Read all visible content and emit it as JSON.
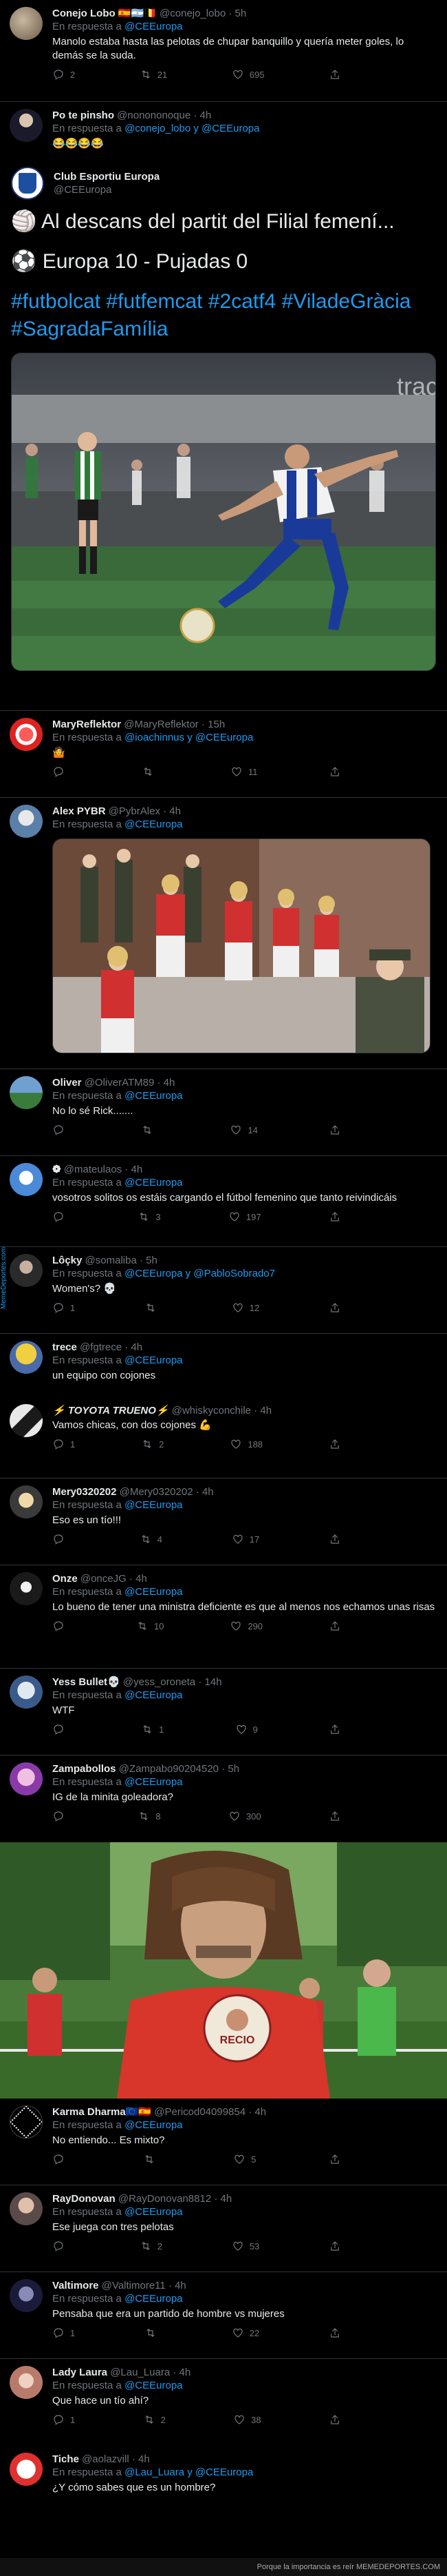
{
  "tweets": [
    {
      "name": "Conejo Lobo 🇪🇸🇦🇷🇧🇪",
      "handle": "@conejo_lobo · 5h",
      "reply_prefix": "En respuesta a ",
      "reply_to": "@CEEuropa",
      "text": "Manolo estaba hasta las pelotas de chupar banquillo y quería meter goles, lo demás se la suda.",
      "replies": "2",
      "retweets": "21",
      "likes": "695"
    },
    {
      "name": "Po te pinsho",
      "handle": "@nonononoque · 4h",
      "reply_prefix": "En respuesta a ",
      "reply_to": "@conejo_lobo y @CEEuropa",
      "text": "😂😂😂😂"
    },
    {
      "name": "Club Esportiu Europa",
      "handle": "@CEEuropa",
      "text_line1": "🏐 Al descans del partit del Filial femení...",
      "text_line2": "⚽ Europa 10 - Pujadas 0",
      "hashtags1": "#futbolcat #futfemcat #2catf4 #ViladeGràcia",
      "hashtags2": "#SagradaFamília"
    },
    {
      "name": "MaryReflektor",
      "handle": "@MaryReflektor · 15h",
      "reply_prefix": "En respuesta a ",
      "reply_to": "@ioachinnus y @CEEuropa",
      "text": "🤷",
      "replies": "",
      "retweets": "",
      "likes": "11"
    },
    {
      "name": "Alex PYBR",
      "handle": "@PybrAlex · 4h",
      "reply_prefix": "En respuesta a ",
      "reply_to": "@CEEuropa"
    },
    {
      "name": "Oliver",
      "handle": "@OliverATM89 · 4h",
      "reply_prefix": "En respuesta a ",
      "reply_to": "@CEEuropa",
      "text": "No lo sé Rick.......",
      "replies": "",
      "retweets": "",
      "likes": "14"
    },
    {
      "name": "❁",
      "handle": "@mateulaos · 4h",
      "reply_prefix": "En respuesta a ",
      "reply_to": "@CEEuropa",
      "text": "vosotros solitos os estáis cargando el fútbol femenino que tanto reivindicáis",
      "replies": "",
      "retweets": "3",
      "likes": "197"
    },
    {
      "name": "Lôçky",
      "handle": "@somaliba · 5h",
      "reply_prefix": "En respuesta a ",
      "reply_to": "@CEEuropa y @PabloSobrado7",
      "text": "Women's? 💀",
      "replies": "1",
      "retweets": "",
      "likes": "12"
    },
    {
      "name": "trece",
      "handle": "@fgtrece · 4h",
      "reply_prefix": "En respuesta a ",
      "reply_to": "@CEEuropa",
      "text": "un equipo con cojones"
    },
    {
      "name": "⚡ TOYOTA TRUENO⚡",
      "handle": "@whiskyconchile · 4h",
      "text": "Vamos chicas, con dos cojones 💪",
      "replies": "1",
      "retweets": "2",
      "likes": "188"
    },
    {
      "name": "Mery0320202",
      "handle": "@Mery0320202 · 4h",
      "reply_prefix": "En respuesta a ",
      "reply_to": "@CEEuropa",
      "text": "Eso es un tío!!!",
      "replies": "",
      "retweets": "4",
      "likes": "17"
    },
    {
      "name": "Onze",
      "handle": "@onceJG · 4h",
      "reply_prefix": "En respuesta a ",
      "reply_to": "@CEEuropa",
      "text": "Lo bueno de tener una ministra deficiente es que al menos nos echamos unas risas",
      "replies": "",
      "retweets": "10",
      "likes": "290"
    },
    {
      "name": "Yess Bullet💀",
      "handle": "@yess_oroneta · 14h",
      "reply_prefix": "En respuesta a ",
      "reply_to": "@CEEuropa",
      "text": "WTF",
      "replies": "",
      "retweets": "1",
      "likes": "9"
    },
    {
      "name": "Zampabollos",
      "handle": "@Zampabo90204520 · 5h",
      "reply_prefix": "En respuesta a ",
      "reply_to": "@CEEuropa",
      "text": "IG de la minita goleadora?",
      "replies": "",
      "retweets": "8",
      "likes": "300"
    },
    {
      "name": "Karma Dharma🇪🇺🇪🇸",
      "handle": "@Pericod04099854 · 4h",
      "reply_prefix": "En respuesta a ",
      "reply_to": "@CEEuropa",
      "text": "No entiendo... Es mixto?",
      "replies": "",
      "retweets": "",
      "likes": "5"
    },
    {
      "name": "RayDonovan",
      "handle": "@RayDonovan8812 · 4h",
      "reply_prefix": "En respuesta a ",
      "reply_to": "@CEEuropa",
      "text": "Ese juega con tres pelotas",
      "replies": "",
      "retweets": "2",
      "likes": "53"
    },
    {
      "name": "Valtimore",
      "handle": "@Valtimore11 · 4h",
      "reply_prefix": "En respuesta a ",
      "reply_to": "@CEEuropa",
      "text": "Pensaba que era un partido de hombre vs mujeres",
      "replies": "1",
      "retweets": "",
      "likes": "22"
    },
    {
      "name": "Lady Laura",
      "handle": "@Lau_Luara · 4h",
      "reply_prefix": "En respuesta a ",
      "reply_to": "@CEEuropa",
      "text": "Que hace un tío ahí?",
      "replies": "1",
      "retweets": "2",
      "likes": "38"
    },
    {
      "name": "Tiche",
      "handle": "@aolazvill · 4h",
      "reply_prefix": "En respuesta a ",
      "reply_to": "@Lau_Luara y @CEEuropa",
      "text": "¿Y cómo sabes que es un hombre?"
    }
  ],
  "watermark": "MemeDeportes.com",
  "footer": "Porque la importancia es reír MEMEDEPORTES.COM",
  "badge_text": "RECIO"
}
